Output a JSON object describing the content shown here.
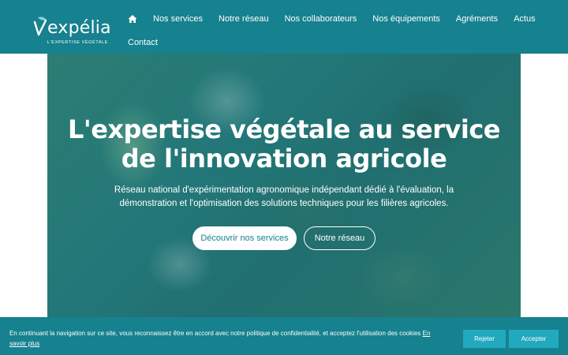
{
  "brand": {
    "name": "expélia",
    "tagline": "L'EXPERTISE VÉGÉTALE"
  },
  "nav": {
    "home_icon": "home-icon",
    "items": [
      "Nos services",
      "Notre réseau",
      "Nos collaborateurs",
      "Nos équipements",
      "Agréments",
      "Actus",
      "Contact"
    ]
  },
  "hero": {
    "title": "L'expertise végétale au service de l'innovation agricole",
    "subtitle": "Réseau national d'expérimentation agronomique indépendant dédié à l'évaluation, la démonstration et l'optimisation des solutions techniques pour les filières agricoles.",
    "primary_button": "Découvrir nos services",
    "secondary_button": "Notre réseau"
  },
  "cookie": {
    "text": "En continuant la navigation sur ce site, vous reconnaissez être en accord avec notre politique de confidentialité, et acceptez l'utilisation des cookies",
    "link": "En savoir plus",
    "reject": "Rejeter",
    "accept": "Accepter"
  },
  "colors": {
    "primary": "#16818f",
    "button_accent": "#22a9bd"
  }
}
